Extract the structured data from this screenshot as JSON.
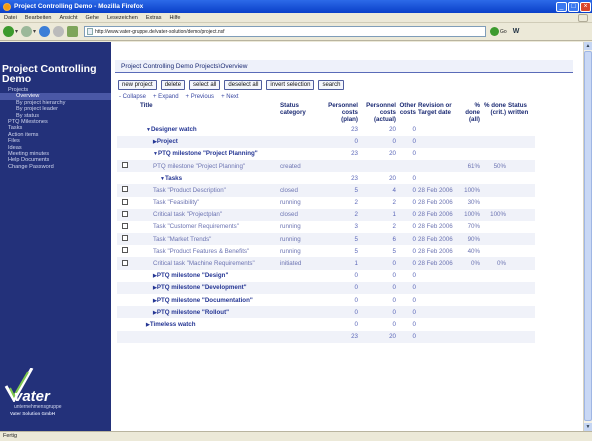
{
  "window": {
    "title": "Project Controlling Demo - Mozilla Firefox",
    "controls": [
      "_",
      "□",
      "×"
    ]
  },
  "menu": [
    "Datei",
    "Bearbeiten",
    "Ansicht",
    "Gehe",
    "Lesezeichen",
    "Extras",
    "Hilfe"
  ],
  "toolbar": {
    "url": "http://www.vater-gruppe.de/vater-solution/demo/project.nsf",
    "go_label": "Go"
  },
  "sidebar": {
    "title": "Project Controlling Demo",
    "items": [
      {
        "label": "Projects",
        "level": 1,
        "active": false
      },
      {
        "label": "Overview",
        "level": 2,
        "active": true
      },
      {
        "label": "By project hierarchy",
        "level": 2,
        "active": false
      },
      {
        "label": "By project leader",
        "level": 2,
        "active": false
      },
      {
        "label": "By status",
        "level": 2,
        "active": false
      },
      {
        "label": "PTQ Milestones",
        "level": 1,
        "active": false
      },
      {
        "label": "Tasks",
        "level": 1,
        "active": false
      },
      {
        "label": "Action items",
        "level": 1,
        "active": false
      },
      {
        "label": "Files",
        "level": 1,
        "active": false
      },
      {
        "label": "Ideas",
        "level": 1,
        "active": false
      },
      {
        "label": "Meeting minutes",
        "level": 1,
        "active": false
      },
      {
        "label": "Help Documents",
        "level": 1,
        "active": false
      },
      {
        "label": "Change Password",
        "level": 1,
        "active": false
      }
    ],
    "logo": {
      "brand": "vater",
      "line1": "unternehmensgruppe",
      "line2": "Vater Solution GmbH"
    }
  },
  "breadcrumb": "Project Controlling Demo Projects\\Overview",
  "buttons": [
    "new project",
    "delete",
    "select all",
    "deselect all",
    "invert selection",
    "search"
  ],
  "view_nav": [
    "- Collapse",
    "+ Expand",
    "+ Previous",
    "+ Next"
  ],
  "table": {
    "headers": [
      {
        "key": "title",
        "label": "Title"
      },
      {
        "key": "status",
        "label": "Status category"
      },
      {
        "key": "pplan",
        "label": "Personnel costs (plan)"
      },
      {
        "key": "pact",
        "label": "Personnel costs (actual)"
      },
      {
        "key": "other",
        "label": "Other costs"
      },
      {
        "key": "rev",
        "label": "Revision or Target date"
      },
      {
        "key": "doneall",
        "label": "% done (all)"
      },
      {
        "key": "donecrit",
        "label": "% done (crit.)"
      },
      {
        "key": "written",
        "label": "Status written"
      }
    ],
    "rows": [
      {
        "chk": false,
        "indent": 1,
        "tri": "▼",
        "grp": true,
        "title": "Designer watch",
        "status": "",
        "pplan": "23",
        "pact": "20",
        "other": "0",
        "rev": "",
        "doneall": "",
        "donecrit": "",
        "written": ""
      },
      {
        "chk": false,
        "indent": 2,
        "tri": "▶",
        "grp": true,
        "title": "Project",
        "status": "",
        "pplan": "0",
        "pact": "0",
        "other": "0",
        "rev": "",
        "doneall": "",
        "donecrit": "",
        "written": ""
      },
      {
        "chk": false,
        "indent": 2,
        "tri": "▼",
        "grp": true,
        "title": "PTQ milestone \"Project Planning\"",
        "status": "",
        "pplan": "23",
        "pact": "20",
        "other": "0",
        "rev": "",
        "doneall": "",
        "donecrit": "",
        "written": ""
      },
      {
        "chk": true,
        "indent": 2,
        "tri": "",
        "grp": false,
        "title": "PTQ milestone \"Project Planning\"",
        "status": "created",
        "pplan": "",
        "pact": "",
        "other": "",
        "rev": "",
        "doneall": "61%",
        "donecrit": "50%",
        "written": ""
      },
      {
        "chk": false,
        "indent": 3,
        "tri": "▼",
        "grp": true,
        "title": "Tasks",
        "status": "",
        "pplan": "23",
        "pact": "20",
        "other": "0",
        "rev": "",
        "doneall": "",
        "donecrit": "",
        "written": ""
      },
      {
        "chk": true,
        "indent": 2,
        "tri": "",
        "grp": false,
        "title": "Task \"Product Description\"",
        "status": "closed",
        "pplan": "5",
        "pact": "4",
        "other": "0",
        "rev": "28 Feb 2006",
        "doneall": "100%",
        "donecrit": "",
        "written": ""
      },
      {
        "chk": true,
        "indent": 2,
        "tri": "",
        "grp": false,
        "title": "Task \"Feasibility\"",
        "status": "running",
        "pplan": "2",
        "pact": "2",
        "other": "0",
        "rev": "28 Feb 2006",
        "doneall": "30%",
        "donecrit": "",
        "written": ""
      },
      {
        "chk": true,
        "indent": 2,
        "tri": "",
        "grp": false,
        "title": "Critical task \"Projectplan\"",
        "status": "closed",
        "pplan": "2",
        "pact": "1",
        "other": "0",
        "rev": "28 Feb 2006",
        "doneall": "100%",
        "donecrit": "100%",
        "written": ""
      },
      {
        "chk": true,
        "indent": 2,
        "tri": "",
        "grp": false,
        "title": "Task \"Customer Requirements\"",
        "status": "running",
        "pplan": "3",
        "pact": "2",
        "other": "0",
        "rev": "28 Feb 2006",
        "doneall": "70%",
        "donecrit": "",
        "written": ""
      },
      {
        "chk": true,
        "indent": 2,
        "tri": "",
        "grp": false,
        "title": "Task \"Market Trends\"",
        "status": "running",
        "pplan": "5",
        "pact": "6",
        "other": "0",
        "rev": "28 Feb 2006",
        "doneall": "90%",
        "donecrit": "",
        "written": ""
      },
      {
        "chk": true,
        "indent": 2,
        "tri": "",
        "grp": false,
        "title": "Task \"Product Features & Benefits\"",
        "status": "running",
        "pplan": "5",
        "pact": "5",
        "other": "0",
        "rev": "28 Feb 2006",
        "doneall": "40%",
        "donecrit": "",
        "written": ""
      },
      {
        "chk": true,
        "indent": 2,
        "tri": "",
        "grp": false,
        "title": "Critical task \"Machine Requirements\"",
        "status": "initiated",
        "pplan": "1",
        "pact": "0",
        "other": "0",
        "rev": "28 Feb 2006",
        "doneall": "0%",
        "donecrit": "0%",
        "written": ""
      },
      {
        "chk": false,
        "indent": 2,
        "tri": "▶",
        "grp": true,
        "title": "PTQ milestone \"Design\"",
        "status": "",
        "pplan": "0",
        "pact": "0",
        "other": "0",
        "rev": "",
        "doneall": "",
        "donecrit": "",
        "written": ""
      },
      {
        "chk": false,
        "indent": 2,
        "tri": "▶",
        "grp": true,
        "title": "PTQ milestone \"Development\"",
        "status": "",
        "pplan": "0",
        "pact": "0",
        "other": "0",
        "rev": "",
        "doneall": "",
        "donecrit": "",
        "written": ""
      },
      {
        "chk": false,
        "indent": 2,
        "tri": "▶",
        "grp": true,
        "title": "PTQ milestone \"Documentation\"",
        "status": "",
        "pplan": "0",
        "pact": "0",
        "other": "0",
        "rev": "",
        "doneall": "",
        "donecrit": "",
        "written": ""
      },
      {
        "chk": false,
        "indent": 2,
        "tri": "▶",
        "grp": true,
        "title": "PTQ milestone \"Rollout\"",
        "status": "",
        "pplan": "0",
        "pact": "0",
        "other": "0",
        "rev": "",
        "doneall": "",
        "donecrit": "",
        "written": ""
      },
      {
        "chk": false,
        "indent": 1,
        "tri": "▶",
        "grp": true,
        "title": "Timeless watch",
        "status": "",
        "pplan": "0",
        "pact": "0",
        "other": "0",
        "rev": "",
        "doneall": "",
        "donecrit": "",
        "written": ""
      },
      {
        "chk": false,
        "indent": 0,
        "tri": "",
        "grp": false,
        "title": "",
        "status": "",
        "pplan": "23",
        "pact": "20",
        "other": "0",
        "rev": "",
        "doneall": "",
        "donecrit": "",
        "written": ""
      }
    ]
  },
  "statusbar": "Fertig",
  "colors": {
    "sidebar_bg": "#23317a",
    "accent": "#253694",
    "titlebar": "#0a3fc8"
  }
}
